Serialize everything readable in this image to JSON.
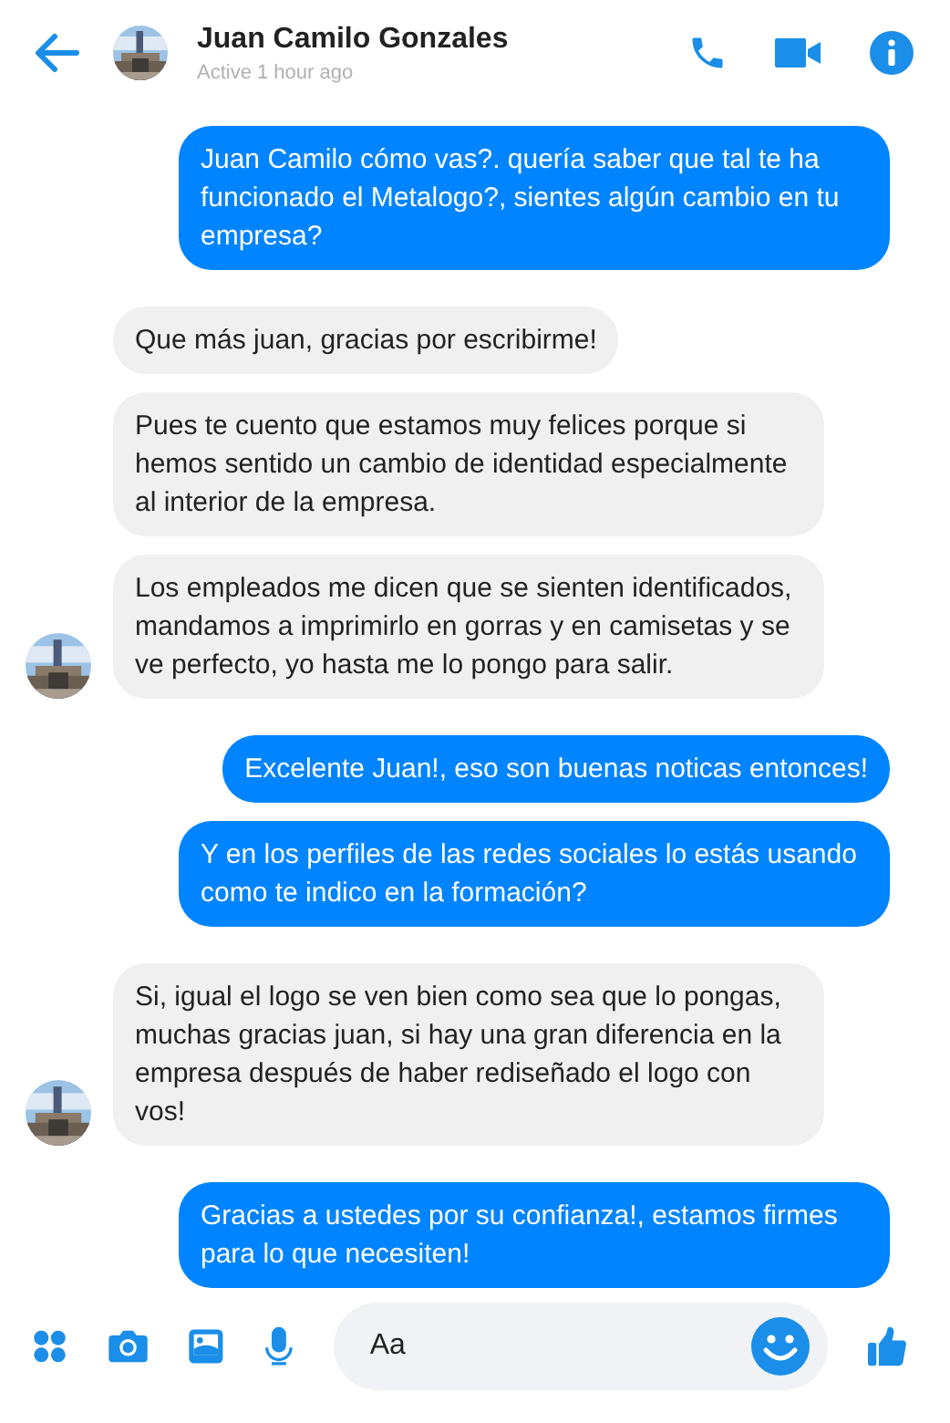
{
  "header": {
    "name": "Juan Camilo Gonzales",
    "status": "Active 1 hour ago"
  },
  "messages": [
    {
      "kind": "sent",
      "avatar": false,
      "text": "Juan Camilo cómo vas?. quería saber que tal te ha funcionado el Metalogo?, sientes algún cambio en tu empresa?"
    },
    {
      "kind": "received",
      "avatar": false,
      "text": "Que más juan, gracias por escribirme!"
    },
    {
      "kind": "received",
      "avatar": false,
      "text": "Pues te cuento que estamos muy felices porque si hemos sentido un cambio de identidad especialmente al interior de la empresa."
    },
    {
      "kind": "received",
      "avatar": true,
      "text": "Los empleados me dicen que se sienten identificados, mandamos a imprimirlo en gorras y en camisetas y se ve perfecto, yo hasta me lo pongo para salir."
    },
    {
      "kind": "sent",
      "avatar": false,
      "text": "Excelente Juan!, eso son buenas noticas entonces!"
    },
    {
      "kind": "sent",
      "avatar": false,
      "text": "Y en los perfiles de las redes sociales lo estás usando como te indico en la formación?"
    },
    {
      "kind": "received",
      "avatar": true,
      "text": "Si, igual el logo se ven bien como sea que lo pongas, muchas gracias juan, si hay una gran diferencia en la empresa después de haber rediseñado el logo con vos!"
    },
    {
      "kind": "sent",
      "avatar": false,
      "text": "Gracias a ustedes por su confianza!, estamos firmes para lo que necesiten!"
    }
  ],
  "composer": {
    "placeholder": "Aa"
  }
}
